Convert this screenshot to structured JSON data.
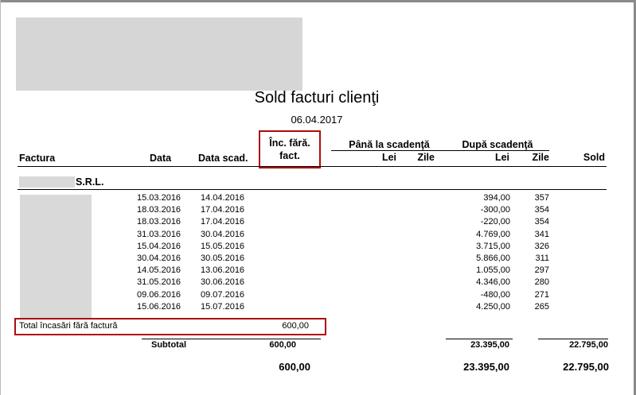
{
  "report": {
    "title": "Sold facturi clienţi",
    "date": "06.04.2017"
  },
  "columns": {
    "factura": "Factura",
    "data": "Data",
    "data_scad": "Data scad.",
    "inc_line1": "Înc. fără.",
    "inc_line2": "fact.",
    "pana_group": "Până la scadenţă",
    "dupa_group": "După scadenţă",
    "lei": "Lei",
    "zile": "Zile",
    "sold": "Sold"
  },
  "client": {
    "name_suffix": "S.R.L."
  },
  "rows": [
    {
      "data": "15.03.2016",
      "scad": "14.04.2016",
      "lei": "394,00",
      "zile": "357"
    },
    {
      "data": "18.03.2016",
      "scad": "17.04.2016",
      "lei": "-300,00",
      "zile": "354"
    },
    {
      "data": "18.03.2016",
      "scad": "17.04.2016",
      "lei": "-220,00",
      "zile": "354"
    },
    {
      "data": "31.03.2016",
      "scad": "30.04.2016",
      "lei": "4.769,00",
      "zile": "341"
    },
    {
      "data": "15.04.2016",
      "scad": "15.05.2016",
      "lei": "3.715,00",
      "zile": "326"
    },
    {
      "data": "30.04.2016",
      "scad": "30.05.2016",
      "lei": "5.866,00",
      "zile": "311"
    },
    {
      "data": "14.05.2016",
      "scad": "13.06.2016",
      "lei": "1.055,00",
      "zile": "297"
    },
    {
      "data": "31.05.2016",
      "scad": "30.06.2016",
      "lei": "4.346,00",
      "zile": "280"
    },
    {
      "data": "09.06.2016",
      "scad": "09.07.2016",
      "lei": "-480,00",
      "zile": "271"
    },
    {
      "data": "15.06.2016",
      "scad": "15.07.2016",
      "lei": "4.250,00",
      "zile": "265"
    }
  ],
  "total_incasari": {
    "label": "Total încasări fără factură",
    "value": "600,00"
  },
  "subtotal": {
    "label": "Subtotal",
    "inc": "600,00",
    "dupa_lei": "23.395,00",
    "sold": "22.795,00"
  },
  "grand_total": {
    "inc": "600,00",
    "dupa_lei": "23.395,00",
    "sold": "22.795,00"
  },
  "colors": {
    "highlight": "#b00a0a",
    "redacted": "#d9d9d9"
  }
}
